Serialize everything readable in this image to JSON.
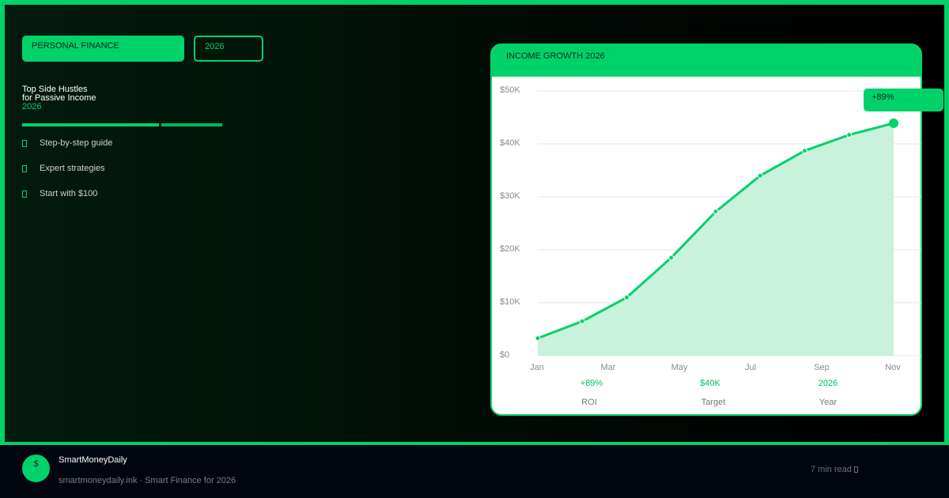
{
  "hero": {
    "category": "PERSONAL FINANCE",
    "year": "2026",
    "headline_line1": "Top Side Hustles",
    "headline_line2": "for Passive Income",
    "headline_accent": "2026",
    "features": [
      "Step-by-step guide",
      "Expert strategies",
      "Start with $100"
    ]
  },
  "card": {
    "title": "INCOME GROWTH 2026",
    "badge": "+89%",
    "stats": [
      {
        "value": "+89%",
        "label": "ROI"
      },
      {
        "value": "$40K",
        "label": "Target"
      },
      {
        "value": "2026",
        "label": "Year"
      }
    ]
  },
  "chart_data": {
    "type": "area",
    "x_labels": [
      "Jan",
      "Mar",
      "May",
      "Jul",
      "Sep",
      "Nov"
    ],
    "y_ticks": [
      "$0",
      "$10K",
      "$20K",
      "$30K",
      "$40K",
      "$50K"
    ],
    "ylim": [
      0,
      50
    ],
    "values": [
      3.3,
      6.5,
      11,
      18.5,
      27.2,
      34,
      38.7,
      41.7,
      43.9
    ],
    "grid": true,
    "color": "#00d26a",
    "fill": "#c8f2dc"
  },
  "footer": {
    "logo": "$",
    "brand": "SmartMoneyDaily",
    "subtitle": "smartmoneydaily.ink · Smart Finance for 2026",
    "read_time": "7 min read"
  },
  "colors": {
    "accent": "#00d26a",
    "background": "#000000"
  }
}
